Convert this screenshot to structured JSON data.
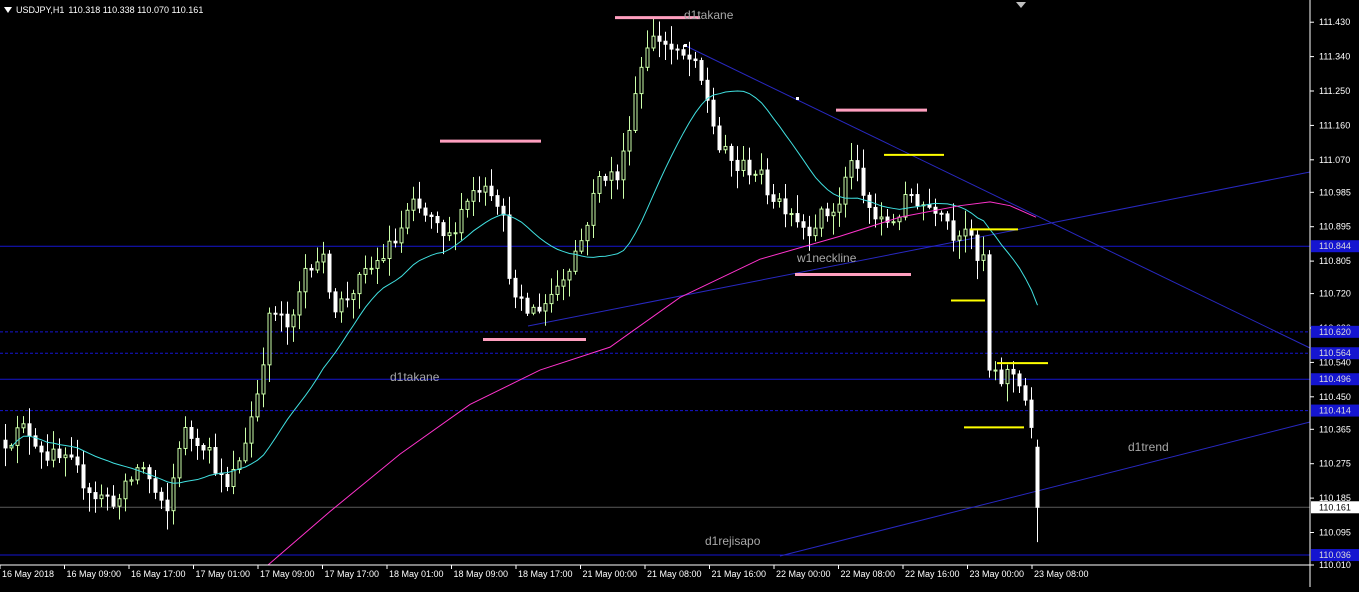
{
  "chart_title": {
    "symbol": "USDJPY,H1",
    "ohlc": "110.318 110.338 110.070 110.161"
  },
  "chart_data": {
    "type": "candlestick",
    "ylim": [
      110.01,
      111.475
    ],
    "price_ticks": [
      "111.430",
      "111.340",
      "111.250",
      "111.160",
      "111.070",
      "110.985",
      "110.895",
      "110.805",
      "110.720",
      "110.630",
      "110.540",
      "110.450",
      "110.365",
      "110.275",
      "110.185",
      "110.095",
      "110.010"
    ],
    "time_ticks": [
      "16 May 2018",
      "16 May 09:00",
      "16 May 17:00",
      "17 May 01:00",
      "17 May 09:00",
      "17 May 17:00",
      "18 May 01:00",
      "18 May 09:00",
      "18 May 17:00",
      "21 May 00:00",
      "21 May 08:00",
      "21 May 16:00",
      "22 May 00:00",
      "22 May 08:00",
      "22 May 16:00",
      "23 May 00:00",
      "23 May 08:00"
    ],
    "current_price": "110.161",
    "price_tags": [
      "110.844",
      "110.620",
      "110.564",
      "110.496",
      "110.414",
      "110.036"
    ],
    "text_labels": [
      "d1takane",
      "d1takane",
      "w1neckline",
      "d1trend",
      "d1rejisapo"
    ],
    "colors": {
      "bull": "#ccffaa",
      "bear": "#ffffff",
      "ma_fast": "#40e0e0",
      "ma_slow": "#ff33cc",
      "hline": "#1515d0",
      "trend": "#2828c0",
      "pink_level": "#ff9fbf",
      "yellow_level": "#ffff00",
      "label": "#a8a8a8",
      "axis_text": "#ffffff"
    }
  }
}
